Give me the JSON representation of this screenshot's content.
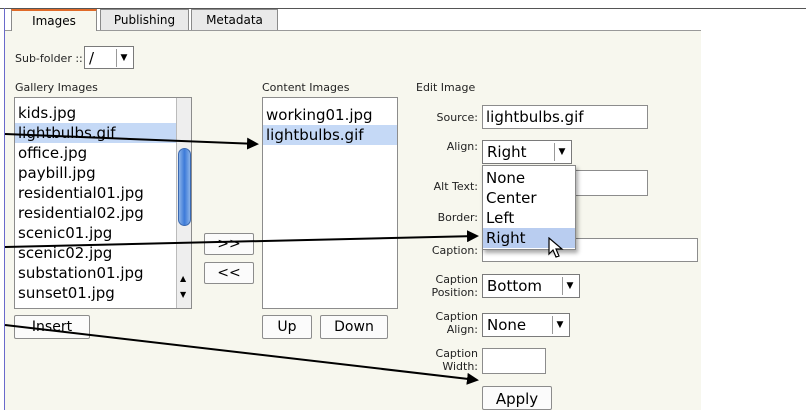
{
  "tabs": [
    {
      "label": "Images",
      "active": true
    },
    {
      "label": "Publishing",
      "active": false
    },
    {
      "label": "Metadata",
      "active": false
    }
  ],
  "subfolder": {
    "label": "Sub-folder ::",
    "value": "/"
  },
  "gallery": {
    "label": "Gallery Images",
    "items": [
      "kids.jpg",
      "lightbulbs.gif",
      "office.jpg",
      "paybill.jpg",
      "residential01.jpg",
      "residential02.jpg",
      "scenic01.jpg",
      "scenic02.jpg",
      "substation01.jpg",
      "sunset01.jpg"
    ],
    "selected": "lightbulbs.gif",
    "insert_label": "Insert"
  },
  "transfer": {
    "add_label": ">>",
    "remove_label": "<<"
  },
  "content": {
    "label": "Content Images",
    "items": [
      "working01.jpg",
      "lightbulbs.gif"
    ],
    "selected": "lightbulbs.gif",
    "up_label": "Up",
    "down_label": "Down"
  },
  "edit": {
    "label": "Edit Image",
    "source_label": "Source:",
    "source_value": "lightbulbs.gif",
    "align_label": "Align:",
    "align_value": "Right",
    "align_options": [
      "None",
      "Center",
      "Left",
      "Right"
    ],
    "align_highlight": "Right",
    "alt_label": "Alt Text:",
    "border_label": "Border:",
    "caption_label": "Caption:",
    "caption_position_label": "Caption Position:",
    "caption_position_value": "Bottom",
    "caption_align_label": "Caption Align:",
    "caption_align_value": "None",
    "caption_width_label": "Caption Width:",
    "apply_label": "Apply"
  },
  "colors": {
    "active_tab_accent": "#e06a28",
    "selection": "#c5d9f6",
    "scroll_thumb": "#3c7ad8"
  }
}
